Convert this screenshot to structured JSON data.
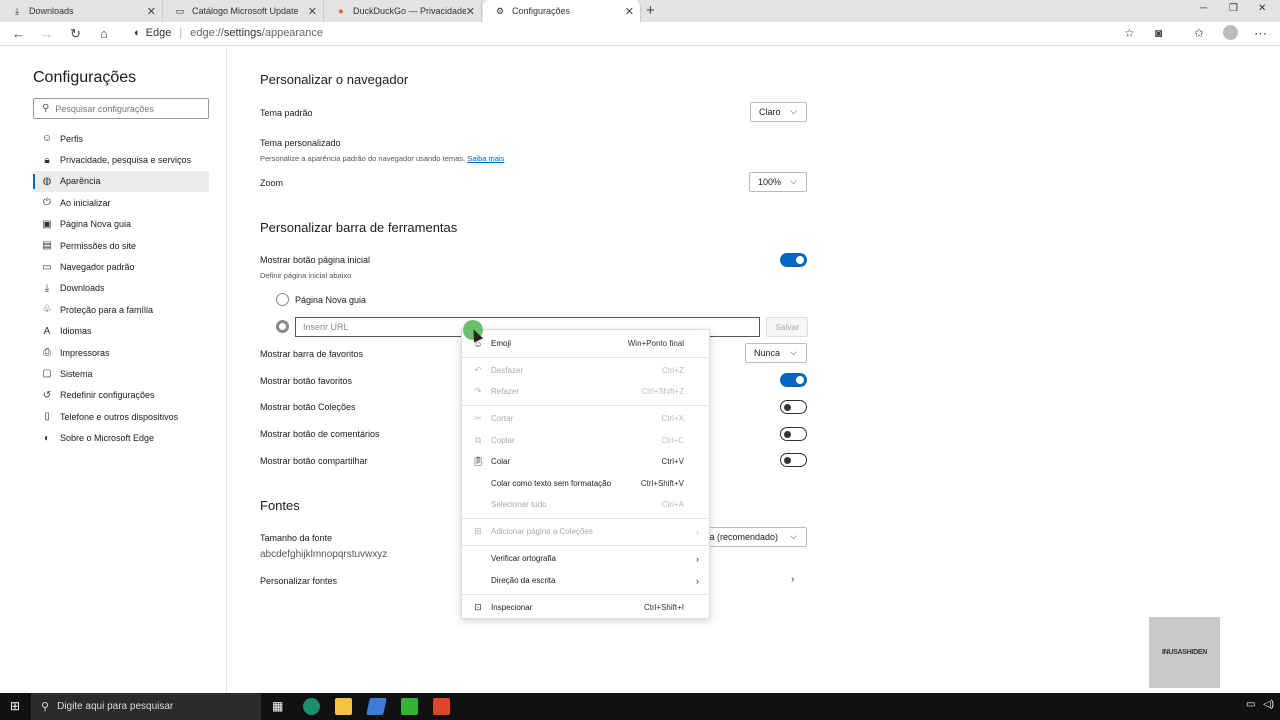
{
  "tabs": [
    {
      "label": "Downloads",
      "icon": "download-icon",
      "close": "✕"
    },
    {
      "label": "Catálogo Microsoft Update",
      "icon": "page-icon",
      "close": "✕"
    },
    {
      "label": "DuckDuckGo — Privacidade simpl",
      "icon": "duckduckgo-icon",
      "close": "✕"
    },
    {
      "label": "Configurações",
      "icon": "gear-icon",
      "close": "✕"
    }
  ],
  "new_tab": "+",
  "address_bar": {
    "site_label": "Edge",
    "separator": "|",
    "url_scheme": "edge://",
    "url_host": "settings",
    "url_path": "/appearance"
  },
  "sidebar": {
    "title": "Configurações",
    "search_placeholder": "Pesquisar configurações",
    "items": [
      {
        "label": "Perfis",
        "icon": "profile-icon"
      },
      {
        "label": "Privacidade, pesquisa e serviços",
        "icon": "lock-icon"
      },
      {
        "label": "Aparência",
        "icon": "palette-icon",
        "active": true
      },
      {
        "label": "Ao inicializar",
        "icon": "power-icon"
      },
      {
        "label": "Página Nova guia",
        "icon": "newtab-icon"
      },
      {
        "label": "Permissões do site",
        "icon": "permissions-icon"
      },
      {
        "label": "Navegador padrão",
        "icon": "browser-icon"
      },
      {
        "label": "Downloads",
        "icon": "download-icon"
      },
      {
        "label": "Proteção para a família",
        "icon": "family-icon"
      },
      {
        "label": "Idiomas",
        "icon": "language-icon"
      },
      {
        "label": "Impressoras",
        "icon": "printer-icon"
      },
      {
        "label": "Sistema",
        "icon": "system-icon"
      },
      {
        "label": "Redefinir configurações",
        "icon": "reset-icon"
      },
      {
        "label": "Telefone e outros dispositivos",
        "icon": "phone-icon"
      },
      {
        "label": "Sobre o Microsoft Edge",
        "icon": "edge-icon"
      }
    ]
  },
  "main": {
    "section1": {
      "title": "Personalizar o navegador",
      "theme_label": "Tema padrão",
      "theme_value": "Claro",
      "custom_theme_label": "Tema personalizado",
      "custom_theme_sub": "Personalize a aparência padrão do navegador usando temas.",
      "custom_theme_link": "Saiba mais",
      "zoom_label": "Zoom",
      "zoom_value": "100%"
    },
    "section2": {
      "title": "Personalizar barra de ferramentas",
      "home_label": "Mostrar botão página inicial",
      "home_sub": "Definir página inicial abaixo",
      "home_toggle": true,
      "radio_newtab": "Página Nova guia",
      "url_placeholder": "Inserir URL",
      "save_label": "Salvar",
      "favbar_label": "Mostrar barra de favoritos",
      "favbar_value": "Nunca",
      "favbtn_label": "Mostrar botão favoritos",
      "favbtn_toggle": true,
      "collections_label": "Mostrar botão Coleções",
      "collections_toggle": false,
      "comments_label": "Mostrar botão de comentários",
      "comments_toggle": false,
      "share_label": "Mostrar botão compartilhar",
      "share_toggle": false
    },
    "section3": {
      "title": "Fontes",
      "size_label": "Tamanho da fonte",
      "size_sample": "abcdefghijklmnopqrstuvwxyz",
      "size_value_visible": "a (recomendado)",
      "custom_fonts_label": "Personalizar fontes"
    }
  },
  "context_menu": {
    "items": [
      {
        "label": "Emoji",
        "shortcut": "Win+Ponto final",
        "icon": "emoji-icon",
        "enabled": true
      },
      {
        "label": "Desfazer",
        "shortcut": "Ctrl+Z",
        "icon": "undo-icon",
        "enabled": false
      },
      {
        "label": "Refazer",
        "shortcut": "Ctrl+Shift+Z",
        "icon": "redo-icon",
        "enabled": false
      },
      {
        "label": "Cortar",
        "shortcut": "Ctrl+X",
        "icon": "cut-icon",
        "enabled": false
      },
      {
        "label": "Copiar",
        "shortcut": "Ctrl+C",
        "icon": "copy-icon",
        "enabled": false
      },
      {
        "label": "Colar",
        "shortcut": "Ctrl+V",
        "icon": "paste-icon",
        "enabled": true
      },
      {
        "label": "Colar como texto sem formatação",
        "shortcut": "Ctrl+Shift+V",
        "icon": "",
        "enabled": true
      },
      {
        "label": "Selecionar tudo",
        "shortcut": "Ctrl+A",
        "icon": "",
        "enabled": false
      },
      {
        "label": "Adicionar página a Coleções",
        "shortcut": "",
        "icon": "collections-icon",
        "enabled": false,
        "submenu": true
      },
      {
        "label": "Verificar ortografia",
        "shortcut": "",
        "icon": "",
        "enabled": true,
        "submenu": true
      },
      {
        "label": "Direção da escrita",
        "shortcut": "",
        "icon": "",
        "enabled": true,
        "submenu": true
      },
      {
        "label": "Inspecionar",
        "shortcut": "Ctrl+Shift+I",
        "icon": "inspect-icon",
        "enabled": true
      }
    ]
  },
  "watermark": "INUSASHIDEN",
  "taskbar": {
    "search_placeholder": "Digite aqui para pesquisar"
  }
}
